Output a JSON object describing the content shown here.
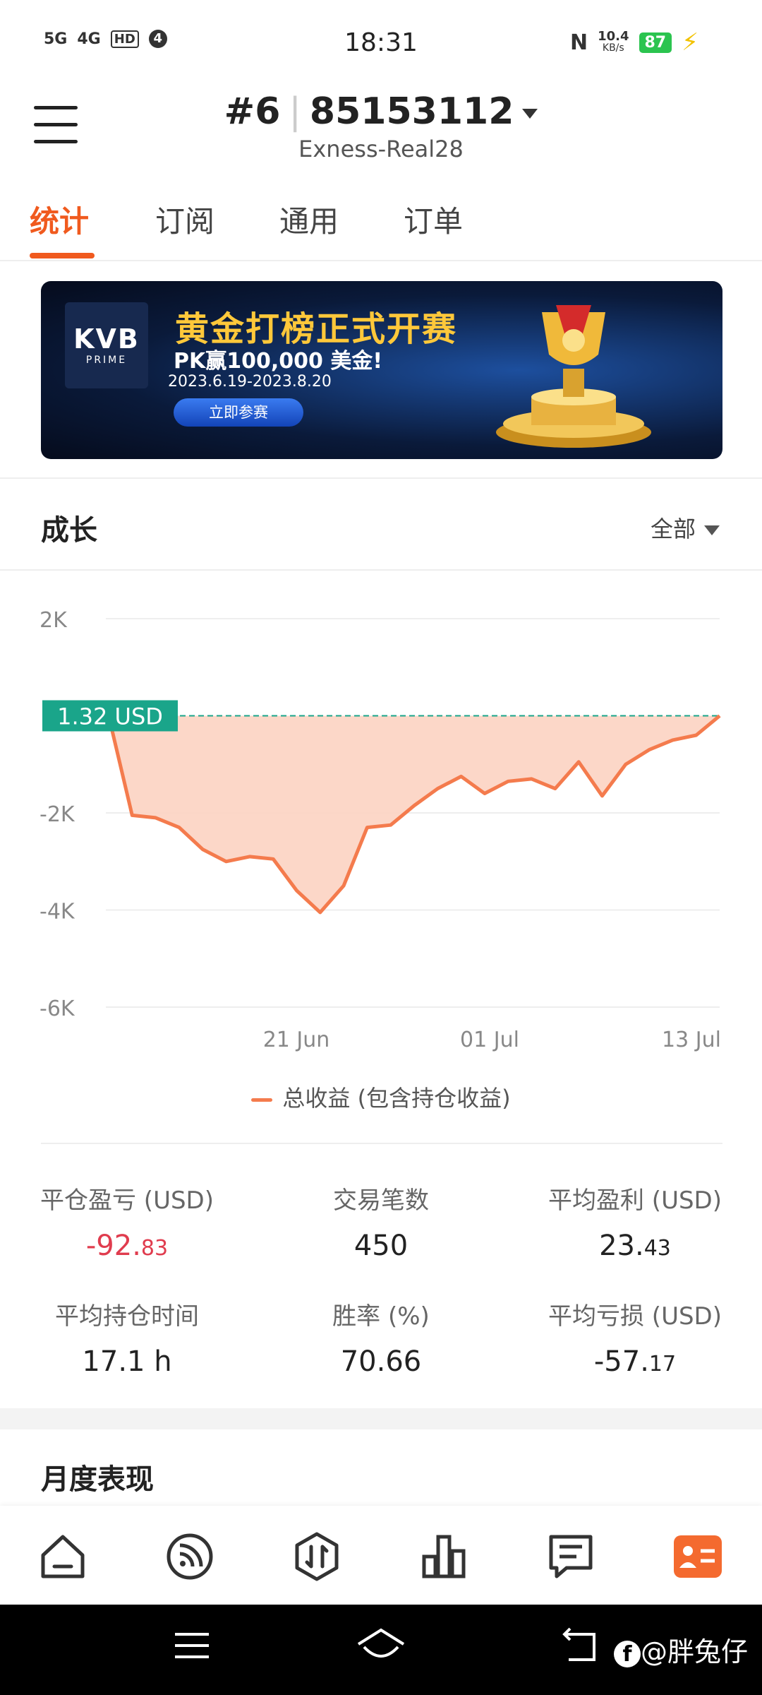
{
  "status_bar": {
    "signal_left": "5G",
    "signal_right": "4G",
    "hd": "HD",
    "notif_count": "4",
    "time": "18:31",
    "speed_value": "10.4",
    "speed_unit": "KB/s",
    "battery": "87"
  },
  "header": {
    "account_index": "#6",
    "account_number": "85153112",
    "server": "Exness-Real28"
  },
  "tabs": [
    {
      "label": "统计"
    },
    {
      "label": "订阅"
    },
    {
      "label": "通用"
    },
    {
      "label": "订单"
    }
  ],
  "banner": {
    "logo_main": "KVB",
    "logo_sub": "PRIME",
    "title": "黄金打榜正式开赛",
    "subtitle": "PK赢100,000 美金!",
    "dates": "2023.6.19-2023.8.20",
    "button": "立即参赛"
  },
  "growth": {
    "title": "成长",
    "filter": "全部"
  },
  "chart_data": {
    "type": "area",
    "y_ticks": [
      "2K",
      "-2K",
      "-4K",
      "-6K"
    ],
    "x_ticks": [
      "21 Jun",
      "01 Jul",
      "13 Jul"
    ],
    "current_label": "1.32 USD",
    "legend": "总收益 (包含持仓收益)",
    "ylim": [
      -6000,
      2000
    ],
    "series": [
      {
        "values": [
          0,
          -2050,
          -2100,
          -2300,
          -2750,
          -3000,
          -2900,
          -2950,
          -3600,
          -4050,
          -3500,
          -2300,
          -2250,
          -1850,
          -1500,
          -1250,
          -1600,
          -1350,
          -1300,
          -1500,
          -950,
          -1650,
          -1000,
          -700,
          -500,
          -400,
          0
        ]
      }
    ],
    "grid": true,
    "color": "#f47b4d",
    "fill": "#fcd3c2",
    "zero_line_color": "#1aa58a"
  },
  "stats": [
    {
      "label": "平仓盈亏 (USD)",
      "int": "-92.",
      "dec": "83",
      "negative": true
    },
    {
      "label": "交易笔数",
      "int": "450",
      "dec": "",
      "negative": false
    },
    {
      "label": "平均盈利 (USD)",
      "int": "23.",
      "dec": "43",
      "negative": false
    },
    {
      "label": "平均持仓时间",
      "int": "17.1 h",
      "dec": "",
      "negative": false
    },
    {
      "label": "胜率 (%)",
      "int": "70.66",
      "dec": "",
      "negative": false
    },
    {
      "label": "平均亏损 (USD)",
      "int": "-57.",
      "dec": "17",
      "negative": false
    }
  ],
  "monthly": {
    "title": "月度表现"
  },
  "nav": [
    "home-icon",
    "feed-icon",
    "trade-icon",
    "chart-icon",
    "message-icon",
    "profile-icon"
  ],
  "watermark": "@胖兔仔"
}
